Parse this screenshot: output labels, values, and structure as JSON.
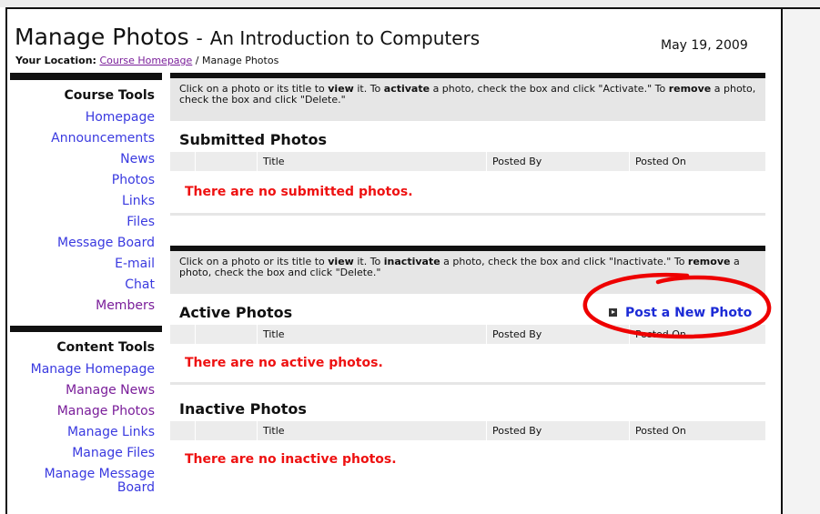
{
  "page": {
    "title": "Manage Photos",
    "separator": "-",
    "course_name": "An Introduction to Computers",
    "date": "May 19, 2009"
  },
  "location": {
    "label": "Your Location:",
    "link": "Course Homepage",
    "separator": "/",
    "current": "Manage Photos"
  },
  "sidebar": {
    "course_tools": {
      "heading": "Course Tools",
      "items": [
        "Homepage",
        "Announcements",
        "News",
        "Photos",
        "Links",
        "Files",
        "Message Board",
        "E-mail",
        "Chat",
        "Members"
      ]
    },
    "content_tools": {
      "heading": "Content Tools",
      "items": [
        "Manage Homepage",
        "Manage News",
        "Manage Photos",
        "Manage Links",
        "Manage Files",
        "Manage Message Board"
      ]
    }
  },
  "submitted": {
    "instructions": [
      "Click on a photo or its title to ",
      "view",
      " it. To ",
      "activate",
      " a photo, check the box and click \"Activate.\" To ",
      "remove",
      " a photo, check the box and click \"Delete.\""
    ],
    "title": "Submitted Photos",
    "columns": [
      "",
      "",
      "Title",
      "Posted By",
      "Posted On"
    ],
    "empty_message": "There are no submitted photos."
  },
  "active": {
    "instructions": [
      "Click on a photo or its title to ",
      "view",
      " it. To ",
      "inactivate",
      " a photo, check the box and click \"Inactivate.\" To ",
      "remove",
      " a photo, check the box and click \"Delete.\""
    ],
    "title": "Active Photos",
    "post_link": "Post a New Photo",
    "columns": [
      "",
      "",
      "Title",
      "Posted By",
      "Posted On"
    ],
    "empty_message": "There are no active photos."
  },
  "inactive": {
    "title": "Inactive Photos",
    "columns": [
      "",
      "",
      "Title",
      "Posted By",
      "Posted On"
    ],
    "empty_message": "There are no inactive photos."
  },
  "colors": {
    "link": "#3a3ae0",
    "visited_link": "#7a1e9a",
    "empty_message": "#ee1111",
    "post_link": "#1c2bd6",
    "annotation": "#ee0000"
  }
}
